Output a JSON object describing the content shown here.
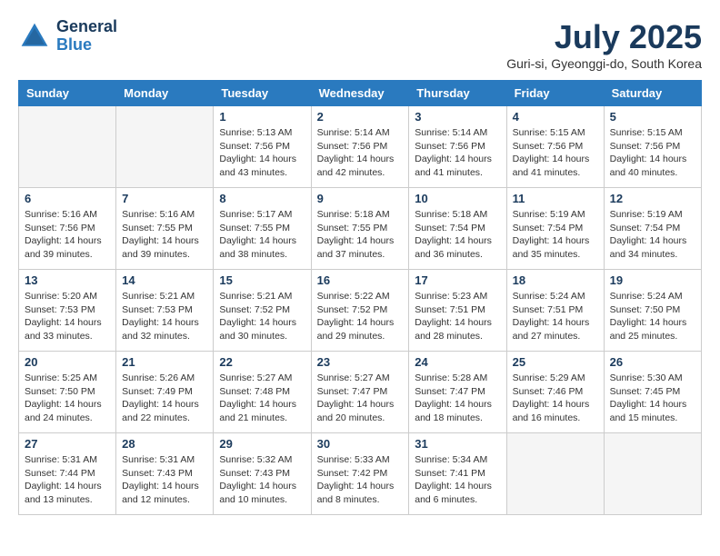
{
  "header": {
    "logo_line1": "General",
    "logo_line2": "Blue",
    "month": "July 2025",
    "location": "Guri-si, Gyeonggi-do, South Korea"
  },
  "days_of_week": [
    "Sunday",
    "Monday",
    "Tuesday",
    "Wednesday",
    "Thursday",
    "Friday",
    "Saturday"
  ],
  "weeks": [
    [
      {
        "day": "",
        "empty": true
      },
      {
        "day": "",
        "empty": true
      },
      {
        "day": "1",
        "sunrise": "Sunrise: 5:13 AM",
        "sunset": "Sunset: 7:56 PM",
        "daylight": "Daylight: 14 hours and 43 minutes."
      },
      {
        "day": "2",
        "sunrise": "Sunrise: 5:14 AM",
        "sunset": "Sunset: 7:56 PM",
        "daylight": "Daylight: 14 hours and 42 minutes."
      },
      {
        "day": "3",
        "sunrise": "Sunrise: 5:14 AM",
        "sunset": "Sunset: 7:56 PM",
        "daylight": "Daylight: 14 hours and 41 minutes."
      },
      {
        "day": "4",
        "sunrise": "Sunrise: 5:15 AM",
        "sunset": "Sunset: 7:56 PM",
        "daylight": "Daylight: 14 hours and 41 minutes."
      },
      {
        "day": "5",
        "sunrise": "Sunrise: 5:15 AM",
        "sunset": "Sunset: 7:56 PM",
        "daylight": "Daylight: 14 hours and 40 minutes."
      }
    ],
    [
      {
        "day": "6",
        "sunrise": "Sunrise: 5:16 AM",
        "sunset": "Sunset: 7:56 PM",
        "daylight": "Daylight: 14 hours and 39 minutes."
      },
      {
        "day": "7",
        "sunrise": "Sunrise: 5:16 AM",
        "sunset": "Sunset: 7:55 PM",
        "daylight": "Daylight: 14 hours and 39 minutes."
      },
      {
        "day": "8",
        "sunrise": "Sunrise: 5:17 AM",
        "sunset": "Sunset: 7:55 PM",
        "daylight": "Daylight: 14 hours and 38 minutes."
      },
      {
        "day": "9",
        "sunrise": "Sunrise: 5:18 AM",
        "sunset": "Sunset: 7:55 PM",
        "daylight": "Daylight: 14 hours and 37 minutes."
      },
      {
        "day": "10",
        "sunrise": "Sunrise: 5:18 AM",
        "sunset": "Sunset: 7:54 PM",
        "daylight": "Daylight: 14 hours and 36 minutes."
      },
      {
        "day": "11",
        "sunrise": "Sunrise: 5:19 AM",
        "sunset": "Sunset: 7:54 PM",
        "daylight": "Daylight: 14 hours and 35 minutes."
      },
      {
        "day": "12",
        "sunrise": "Sunrise: 5:19 AM",
        "sunset": "Sunset: 7:54 PM",
        "daylight": "Daylight: 14 hours and 34 minutes."
      }
    ],
    [
      {
        "day": "13",
        "sunrise": "Sunrise: 5:20 AM",
        "sunset": "Sunset: 7:53 PM",
        "daylight": "Daylight: 14 hours and 33 minutes."
      },
      {
        "day": "14",
        "sunrise": "Sunrise: 5:21 AM",
        "sunset": "Sunset: 7:53 PM",
        "daylight": "Daylight: 14 hours and 32 minutes."
      },
      {
        "day": "15",
        "sunrise": "Sunrise: 5:21 AM",
        "sunset": "Sunset: 7:52 PM",
        "daylight": "Daylight: 14 hours and 30 minutes."
      },
      {
        "day": "16",
        "sunrise": "Sunrise: 5:22 AM",
        "sunset": "Sunset: 7:52 PM",
        "daylight": "Daylight: 14 hours and 29 minutes."
      },
      {
        "day": "17",
        "sunrise": "Sunrise: 5:23 AM",
        "sunset": "Sunset: 7:51 PM",
        "daylight": "Daylight: 14 hours and 28 minutes."
      },
      {
        "day": "18",
        "sunrise": "Sunrise: 5:24 AM",
        "sunset": "Sunset: 7:51 PM",
        "daylight": "Daylight: 14 hours and 27 minutes."
      },
      {
        "day": "19",
        "sunrise": "Sunrise: 5:24 AM",
        "sunset": "Sunset: 7:50 PM",
        "daylight": "Daylight: 14 hours and 25 minutes."
      }
    ],
    [
      {
        "day": "20",
        "sunrise": "Sunrise: 5:25 AM",
        "sunset": "Sunset: 7:50 PM",
        "daylight": "Daylight: 14 hours and 24 minutes."
      },
      {
        "day": "21",
        "sunrise": "Sunrise: 5:26 AM",
        "sunset": "Sunset: 7:49 PM",
        "daylight": "Daylight: 14 hours and 22 minutes."
      },
      {
        "day": "22",
        "sunrise": "Sunrise: 5:27 AM",
        "sunset": "Sunset: 7:48 PM",
        "daylight": "Daylight: 14 hours and 21 minutes."
      },
      {
        "day": "23",
        "sunrise": "Sunrise: 5:27 AM",
        "sunset": "Sunset: 7:47 PM",
        "daylight": "Daylight: 14 hours and 20 minutes."
      },
      {
        "day": "24",
        "sunrise": "Sunrise: 5:28 AM",
        "sunset": "Sunset: 7:47 PM",
        "daylight": "Daylight: 14 hours and 18 minutes."
      },
      {
        "day": "25",
        "sunrise": "Sunrise: 5:29 AM",
        "sunset": "Sunset: 7:46 PM",
        "daylight": "Daylight: 14 hours and 16 minutes."
      },
      {
        "day": "26",
        "sunrise": "Sunrise: 5:30 AM",
        "sunset": "Sunset: 7:45 PM",
        "daylight": "Daylight: 14 hours and 15 minutes."
      }
    ],
    [
      {
        "day": "27",
        "sunrise": "Sunrise: 5:31 AM",
        "sunset": "Sunset: 7:44 PM",
        "daylight": "Daylight: 14 hours and 13 minutes."
      },
      {
        "day": "28",
        "sunrise": "Sunrise: 5:31 AM",
        "sunset": "Sunset: 7:43 PM",
        "daylight": "Daylight: 14 hours and 12 minutes."
      },
      {
        "day": "29",
        "sunrise": "Sunrise: 5:32 AM",
        "sunset": "Sunset: 7:43 PM",
        "daylight": "Daylight: 14 hours and 10 minutes."
      },
      {
        "day": "30",
        "sunrise": "Sunrise: 5:33 AM",
        "sunset": "Sunset: 7:42 PM",
        "daylight": "Daylight: 14 hours and 8 minutes."
      },
      {
        "day": "31",
        "sunrise": "Sunrise: 5:34 AM",
        "sunset": "Sunset: 7:41 PM",
        "daylight": "Daylight: 14 hours and 6 minutes."
      },
      {
        "day": "",
        "empty": true
      },
      {
        "day": "",
        "empty": true
      }
    ]
  ]
}
